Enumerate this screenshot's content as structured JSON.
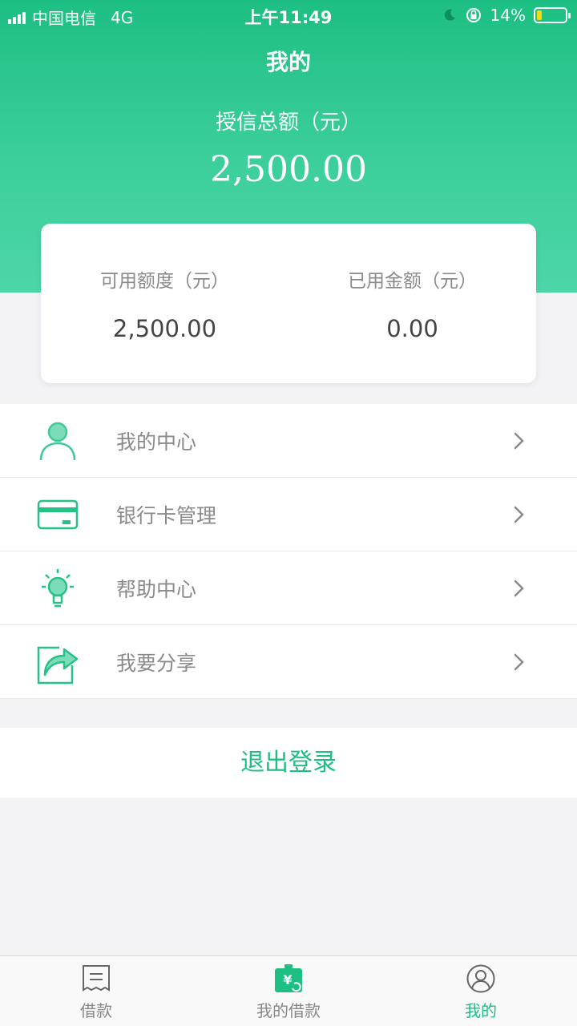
{
  "status_bar": {
    "carrier": "中国电信",
    "network": "4G",
    "time": "上午11:49",
    "battery_percent": "14%",
    "battery_level": 0.14
  },
  "header": {
    "title": "我的",
    "credit_label": "授信总额（元）",
    "credit_value": "2,500.00"
  },
  "summary": {
    "available_label": "可用额度（元）",
    "available_value": "2,500.00",
    "used_label": "已用金额（元）",
    "used_value": "0.00"
  },
  "menu": {
    "items": [
      {
        "label": "我的中心",
        "icon": "user-icon"
      },
      {
        "label": "银行卡管理",
        "icon": "bank-card-icon"
      },
      {
        "label": "帮助中心",
        "icon": "lightbulb-icon"
      },
      {
        "label": "我要分享",
        "icon": "share-icon"
      }
    ]
  },
  "logout_label": "退出登录",
  "tabbar": {
    "tabs": [
      {
        "label": "借款",
        "icon": "receipt-icon"
      },
      {
        "label": "我的借款",
        "icon": "wallet-icon"
      },
      {
        "label": "我的",
        "icon": "profile-icon"
      }
    ],
    "active_index": 2
  },
  "colors": {
    "accent": "#1dbf82",
    "header_gradient_end": "#4dd6a9",
    "battery_fill": "#f5d90a"
  }
}
